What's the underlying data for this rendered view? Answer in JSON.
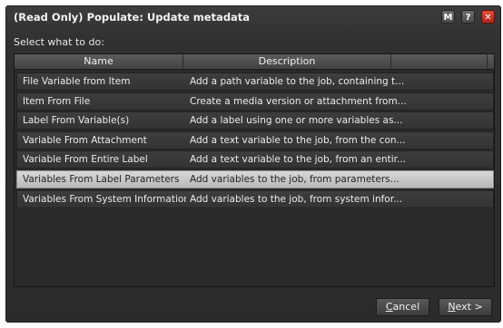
{
  "window": {
    "title": "(Read Only) Populate: Update metadata",
    "buttons": {
      "m_label": "M",
      "help_label": "?",
      "close_label": "✕"
    }
  },
  "prompt": "Select what to do:",
  "list": {
    "columns": {
      "name": "Name",
      "description": "Description"
    },
    "rows": [
      {
        "name": "File Variable from Item",
        "description": "Add a path variable to the job, containing t..."
      },
      {
        "name": "Item From File",
        "description": "Create a media version or attachment from..."
      },
      {
        "name": "Label From Variable(s)",
        "description": "Add a label using one or more variables as..."
      },
      {
        "name": "Variable From Attachment",
        "description": "Add a text variable to the job, from the con..."
      },
      {
        "name": "Variable From Entire Label",
        "description": "Add a text variable to the job, from an entir..."
      },
      {
        "name": "Variables From Label Parameters",
        "description": "Add variables to the job, from parameters...",
        "selected": true
      },
      {
        "name": "Variables From System Information",
        "description": "Add variables to the job, from system infor..."
      }
    ]
  },
  "footer": {
    "cancel_underlined": "C",
    "cancel_rest": "ancel",
    "next_underlined": "N",
    "next_rest": "ext >"
  },
  "colors": {
    "selected_row": "#c8c8c8",
    "close_button": "#d2382a",
    "panel_bg": "#2b2b2b"
  }
}
